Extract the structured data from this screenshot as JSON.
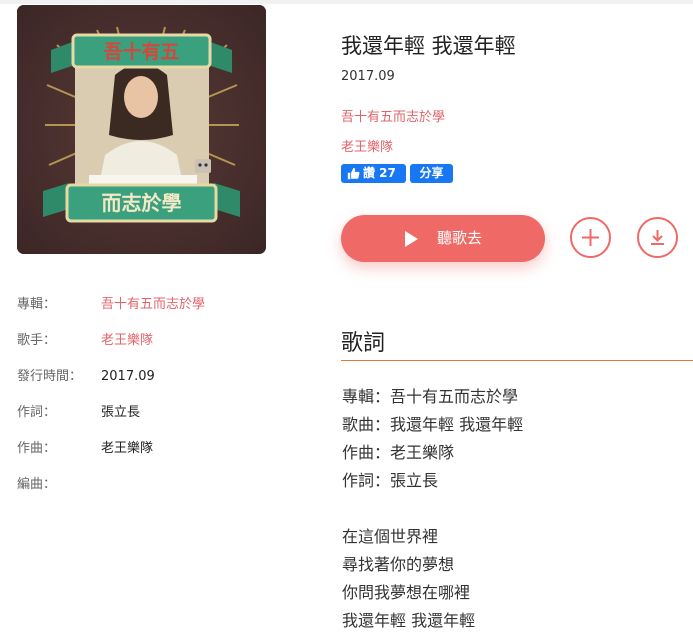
{
  "song": {
    "title": "我還年輕 我還年輕",
    "date": "2017.09",
    "album": "吾十有五而志於學",
    "artist": "老王樂隊"
  },
  "social": {
    "like_label": "讚 27",
    "share_label": "分享"
  },
  "actions": {
    "listen_label": "聽歌去"
  },
  "cover": {
    "banner_top": "吾十有五",
    "banner_bottom": "而志於學"
  },
  "meta": [
    {
      "key": "專輯：",
      "value": "吾十有五而志於學"
    },
    {
      "key": "歌手：",
      "value": "老王樂隊"
    },
    {
      "key": "發行時間：",
      "value": "2017.09"
    },
    {
      "key": "作詞：",
      "value": "張立長"
    },
    {
      "key": "作曲：",
      "value": "老王樂隊"
    },
    {
      "key": "編曲：",
      "value": ""
    }
  ],
  "lyrics": {
    "heading": "歌詞",
    "credits": [
      "專輯：吾十有五而志於學",
      "歌曲：我還年輕 我還年輕",
      "作曲：老王樂隊",
      "作詞：張立長"
    ],
    "lines": [
      "在這個世界裡",
      "尋找著你的夢想",
      "你問我夢想在哪裡",
      "我還年輕 我還年輕"
    ]
  },
  "colors": {
    "accent": "#ef6a66",
    "link": "#e1646b",
    "facebook": "#1877f2",
    "divider": "#e07b36"
  }
}
